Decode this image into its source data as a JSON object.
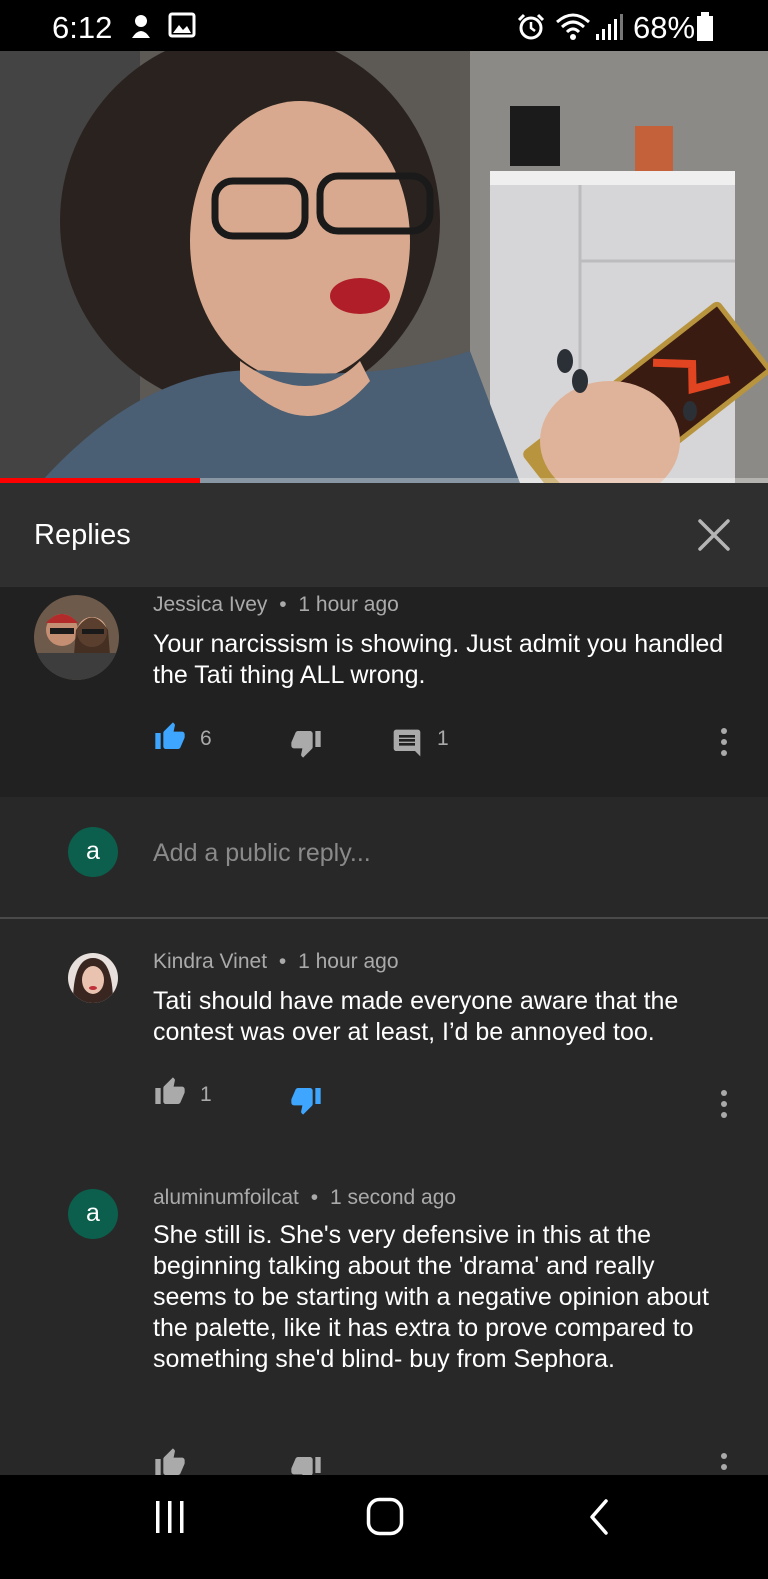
{
  "status_bar": {
    "time": "6:12",
    "battery_percent": "68%"
  },
  "video": {
    "progress_fraction": 0.26
  },
  "panel": {
    "title": "Replies"
  },
  "parent_comment": {
    "author": "Jessica Ivey",
    "separator": "•",
    "time": "1 hour ago",
    "text": "Your narcissism is showing. Just admit you handled the Tati thing ALL wrong.",
    "likes": "6",
    "replies": "1"
  },
  "reply_box": {
    "avatar_letter": "a",
    "placeholder": "Add a public reply..."
  },
  "replies": [
    {
      "author": "Kindra Vinet",
      "separator": "•",
      "time": "1 hour ago",
      "text": "Tati should have made everyone aware that the contest was over at least, I’d be annoyed too.",
      "likes": "1"
    },
    {
      "avatar_letter": "a",
      "author": "aluminumfoilcat",
      "separator": "•",
      "time": "1 second ago",
      "text": "She still is. She's very defensive in this at the beginning talking about the 'drama' and really seems to be starting with a negative opinion about the palette, like it has extra to prove compared to something she'd blind- buy from Sephora."
    }
  ],
  "colors": {
    "accent_blue": "#3ea6ff",
    "progress_red": "#ff0000",
    "avatar_green": "#0b5f4c"
  }
}
